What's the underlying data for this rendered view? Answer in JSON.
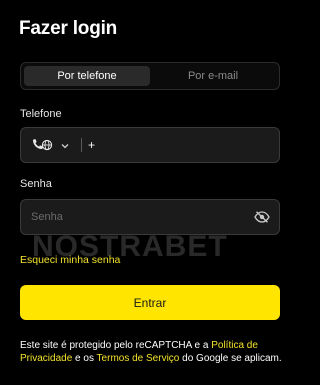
{
  "header": {
    "title": "Fazer login"
  },
  "tabs": [
    {
      "label": "Por telefone",
      "active": true
    },
    {
      "label": "Por e-mail",
      "active": false
    }
  ],
  "phone": {
    "label": "Telefone",
    "prefix": "+",
    "value": "",
    "icon": "phone-globe-icon"
  },
  "password": {
    "label": "Senha",
    "placeholder": "Senha",
    "value": "",
    "icon": "eye-slash-icon"
  },
  "forgot_link": "Esqueci minha senha",
  "submit_label": "Entrar",
  "watermark": {
    "text": "NOSTRABET"
  },
  "recaptcha": {
    "part1": "Este site é protegido pelo reCAPTCHA e a ",
    "privacy_link": "Política de Privacidade",
    "part2": " e os ",
    "terms_link": "Termos de Serviço",
    "part3": " do Google se aplicam."
  },
  "colors": {
    "background": "#000000",
    "accent": "#ffe500",
    "link": "#f2e22a",
    "field_bg": "#1b1b1b"
  }
}
